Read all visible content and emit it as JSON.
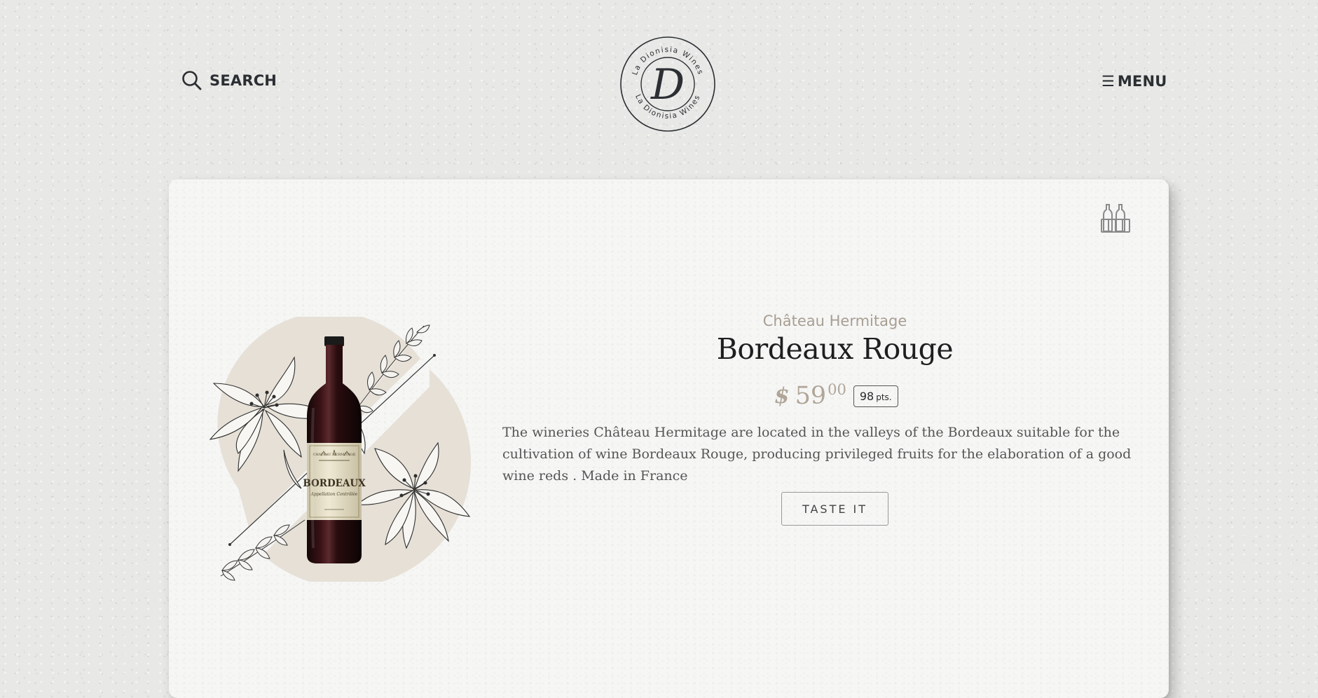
{
  "header": {
    "search_label": "SEARCH",
    "menu_glyph": "☰",
    "menu_label": "MENU",
    "logo": {
      "monogram": "D",
      "ring_text": "La Dionisia Wines"
    }
  },
  "product": {
    "winery": "Château Hermitage",
    "name": "Bordeaux Rouge",
    "price": {
      "currency": "$",
      "integer": "59",
      "cents": "00"
    },
    "points": {
      "value": "98",
      "unit": "pts."
    },
    "description": "The wineries Château Hermitage are located in the valleys of the Bordeaux suitable for the cultivation of wine Bordeaux Rouge, producing privileged fruits for the elaboration of a good wine reds . Made in France",
    "cta_label": "TASTE IT",
    "bottle_label": {
      "top": "CHATEAU HERMITAGE",
      "main": "BORDEAUX",
      "sub": "Appellation Contrôlée"
    }
  },
  "icons": {
    "search": "search-icon",
    "menu": "hamburger-menu-icon",
    "cellar": "wine-bottles-icon"
  },
  "colors": {
    "background": "#e8e8e6",
    "card": "#f6f6f5",
    "text_dark": "#2b2f33",
    "accent_taupe": "#a89e92",
    "price": "#b0a698",
    "wine": "#3a1216"
  }
}
